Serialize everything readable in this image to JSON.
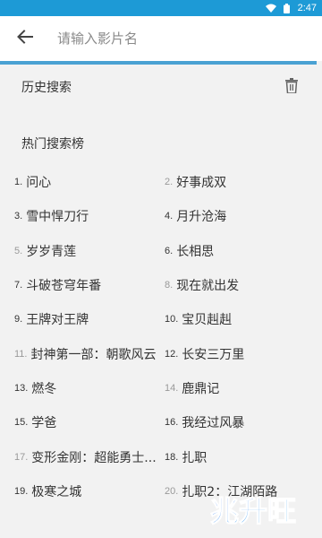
{
  "status_bar": {
    "time": "2:47"
  },
  "search": {
    "placeholder": "请输入影片名"
  },
  "history": {
    "title": "历史搜索"
  },
  "hot": {
    "title": "热门搜索榜",
    "items": [
      {
        "rank": "1.",
        "name": "问心"
      },
      {
        "rank": "2.",
        "name": "好事成双"
      },
      {
        "rank": "3.",
        "name": "雪中悍刀行"
      },
      {
        "rank": "4.",
        "name": "月升沧海"
      },
      {
        "rank": "5.",
        "name": "岁岁青莲"
      },
      {
        "rank": "6.",
        "name": "长相思"
      },
      {
        "rank": "7.",
        "name": "斗破苍穹年番"
      },
      {
        "rank": "8.",
        "name": "现在就出发"
      },
      {
        "rank": "9.",
        "name": "王牌对王牌"
      },
      {
        "rank": "10.",
        "name": "宝贝赳赳"
      },
      {
        "rank": "11.",
        "name": "封神第一部：朝歌风云"
      },
      {
        "rank": "12.",
        "name": "长安三万里"
      },
      {
        "rank": "13.",
        "name": "燃冬"
      },
      {
        "rank": "14.",
        "name": "鹿鼎记"
      },
      {
        "rank": "15.",
        "name": "学爸"
      },
      {
        "rank": "16.",
        "name": "我经过风暴"
      },
      {
        "rank": "17.",
        "name": "变形金刚：超能勇士..."
      },
      {
        "rank": "18.",
        "name": "扎职"
      },
      {
        "rank": "19.",
        "name": "极寒之城"
      },
      {
        "rank": "20.",
        "name": "扎职2：江湖陌路"
      }
    ]
  },
  "watermark": {
    "text": "兆升旺"
  },
  "colors": {
    "accent": "#1d9ad6",
    "underline": "#4aa1d3",
    "background": "#f2f2f2"
  }
}
